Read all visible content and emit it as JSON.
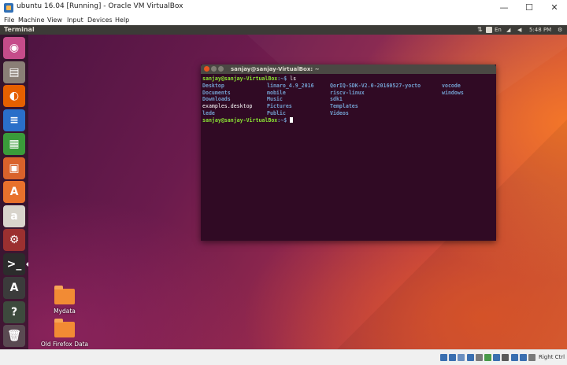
{
  "window": {
    "title": "ubuntu 16.04 [Running] - Oracle VM VirtualBox",
    "minimize_glyph": "—",
    "maximize_glyph": "☐",
    "close_glyph": "✕"
  },
  "menu": [
    "File",
    "Machine",
    "View",
    "Input",
    "Devices",
    "Help"
  ],
  "guest": {
    "topbar_label": "Terminal",
    "tray": {
      "lang": "En",
      "clock": "5:48 PM"
    }
  },
  "launcher": [
    {
      "name": "ubuntu-dash-icon",
      "glyph": "◉",
      "color": "#c54c8a"
    },
    {
      "name": "files-icon",
      "glyph": "▤",
      "color": "#8a7f76"
    },
    {
      "name": "firefox-icon",
      "glyph": "◐",
      "color": "#e66000"
    },
    {
      "name": "writer-icon",
      "glyph": "≡",
      "color": "#2a6fc9"
    },
    {
      "name": "calc-icon",
      "glyph": "▦",
      "color": "#3a9b3a"
    },
    {
      "name": "impress-icon",
      "glyph": "▣",
      "color": "#d9622b"
    },
    {
      "name": "software-center-icon",
      "glyph": "A",
      "color": "#e8712c"
    },
    {
      "name": "amazon-icon",
      "glyph": "a",
      "color": "#d8d4cc"
    },
    {
      "name": "system-settings-icon",
      "glyph": "⚙",
      "color": "#9b3030"
    },
    {
      "name": "terminal-icon",
      "glyph": ">_",
      "color": "#2c2c2c"
    },
    {
      "name": "updater-icon",
      "glyph": "A",
      "color": "#3b3b3b"
    },
    {
      "name": "unknown-app-icon",
      "glyph": "?",
      "color": "#3d4a3d"
    },
    {
      "name": "trash-icon",
      "glyph": "🗑",
      "color": "#5a4a52"
    }
  ],
  "desktop_icons": [
    {
      "label": "Mydata"
    },
    {
      "label": "Old Firefox Data"
    }
  ],
  "terminal": {
    "title": "sanjay@sanjay-VirtualBox: ~",
    "prompt_user": "sanjay@sanjay-VirtualBox",
    "prompt_path": ":~$ ",
    "command": "ls",
    "rows": [
      [
        {
          "text": "Desktop",
          "kind": "dir"
        },
        {
          "text": "linaro_4.9_2016",
          "kind": "dir"
        },
        {
          "text": "QorIQ-SDK-V2.0-20160527-yocto",
          "kind": "dir"
        },
        {
          "text": "vocode",
          "kind": "dir"
        }
      ],
      [
        {
          "text": "Documents",
          "kind": "dir"
        },
        {
          "text": "mobile",
          "kind": "dir"
        },
        {
          "text": "riscv-linux",
          "kind": "dir"
        },
        {
          "text": "windows",
          "kind": "dir"
        }
      ],
      [
        {
          "text": "Downloads",
          "kind": "dir"
        },
        {
          "text": "Music",
          "kind": "dir"
        },
        {
          "text": "sdk1",
          "kind": "dir"
        },
        {
          "text": "",
          "kind": "dir"
        }
      ],
      [
        {
          "text": "examples.desktop",
          "kind": "file"
        },
        {
          "text": "Pictures",
          "kind": "dir"
        },
        {
          "text": "Templates",
          "kind": "dir"
        },
        {
          "text": "",
          "kind": "dir"
        }
      ],
      [
        {
          "text": "lede",
          "kind": "dir"
        },
        {
          "text": "Public",
          "kind": "dir"
        },
        {
          "text": "Videos",
          "kind": "dir"
        },
        {
          "text": "",
          "kind": "dir"
        }
      ]
    ]
  },
  "statusbar": {
    "host_key": "Right Ctrl",
    "icon_colors": [
      "#3a6fb0",
      "#3a6fb0",
      "#6b8fbf",
      "#3a6fb0",
      "#7a7a7a",
      "#4a9a4a",
      "#3a6fb0",
      "#5a5a5a",
      "#3a6fb0",
      "#3a6fb0",
      "#7a7a7a"
    ]
  }
}
